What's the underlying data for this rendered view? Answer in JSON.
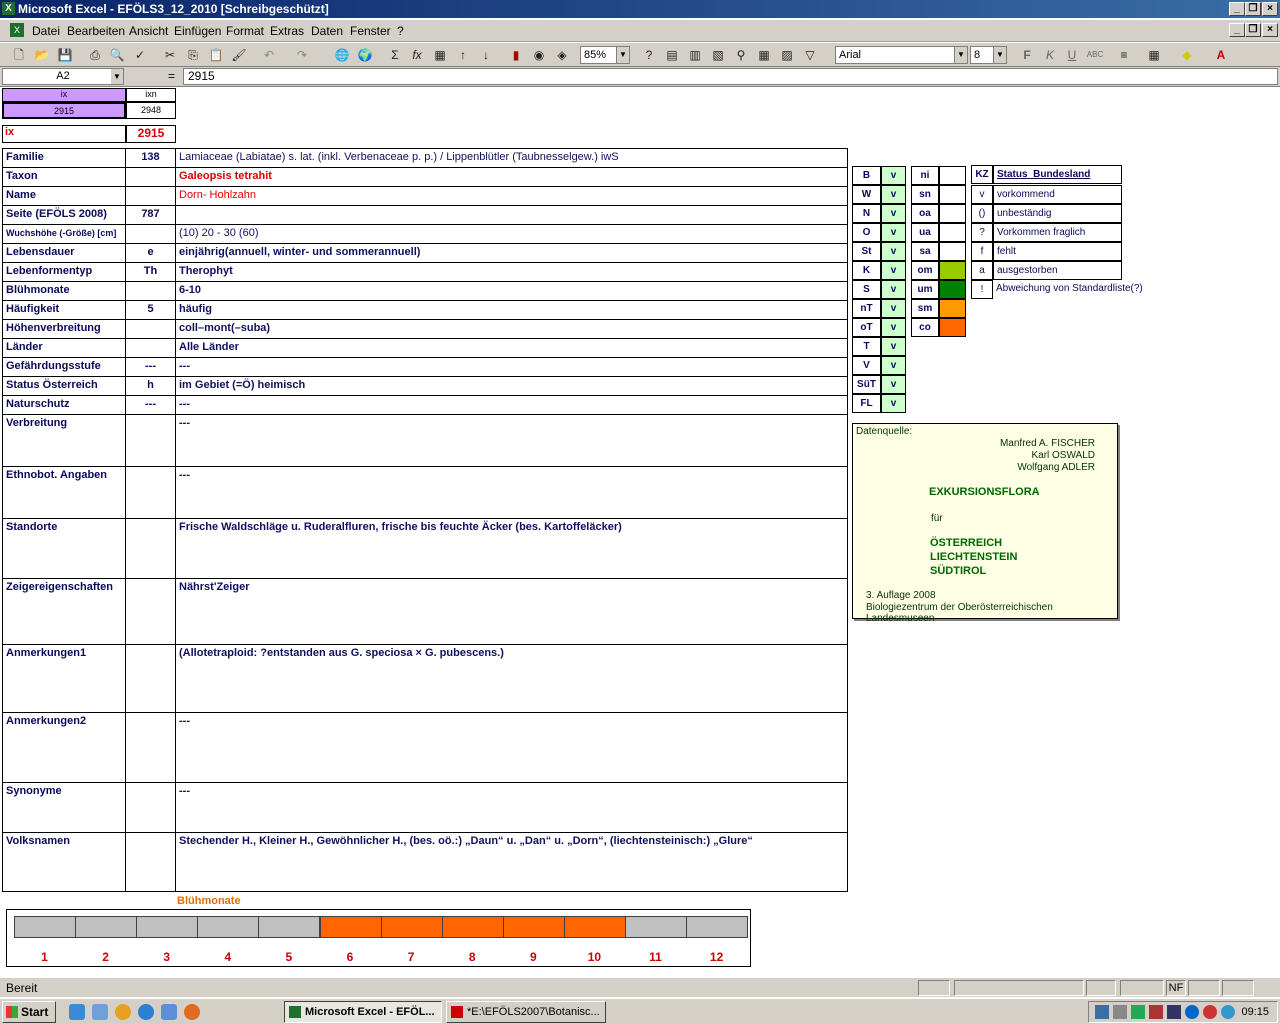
{
  "window": {
    "title": "Microsoft Excel - EFÖLS3_12_2010  [Schreibgeschützt]"
  },
  "menu": [
    "Datei",
    "Bearbeiten",
    "Ansicht",
    "Einfügen",
    "Format",
    "Extras",
    "Daten",
    "Fenster",
    "?"
  ],
  "toolbar": {
    "zoom": "85%",
    "font": "Arial",
    "size": "8",
    "bold": "F",
    "italic": "K",
    "underline": "U"
  },
  "formula": {
    "namebox": "A2",
    "eq": "=",
    "value": "2915"
  },
  "top": {
    "ix_header": "ix",
    "ixn_header": "ixn",
    "ix_val": "2915",
    "ixn_val": "2948",
    "ix_label": "ix",
    "ix_big": "2915"
  },
  "rows": [
    {
      "label": "Familie",
      "code": "138",
      "text": "Lamiaceae (Labiatae) s. lat. (inkl. Verbenaceae p. p.)  /  Lippenblütler (Taubnesselgew.) iwS"
    },
    {
      "label": "Taxon",
      "code": "",
      "text": "Galeopsis tetrahit"
    },
    {
      "label": "Name",
      "code": "",
      "text": "Dorn- Hohlzahn"
    },
    {
      "label": "Seite (EFÖLS 2008)",
      "code": "787",
      "text": ""
    },
    {
      "label": "Wuchshöhe (-Größe) [cm]",
      "code": "",
      "text": "(10) 20 - 30 (60)"
    },
    {
      "label": "Lebensdauer",
      "code": "e",
      "text": "einjährig(annuell, winter- und sommerannuell)"
    },
    {
      "label": "Lebenformentyp",
      "code": "Th",
      "text": "Therophyt"
    },
    {
      "label": "Blühmonate",
      "code": "",
      "text": "6-10"
    },
    {
      "label": "Häufigkeit",
      "code": "5",
      "text": "häufig"
    },
    {
      "label": "Höhenverbreitung",
      "code": "",
      "text": "coll–mont(–suba)"
    },
    {
      "label": "Länder",
      "code": "",
      "text": "Alle Länder"
    },
    {
      "label": "Gefährdungsstufe",
      "code": "---",
      "text": "---"
    },
    {
      "label": "Status Österreich",
      "code": "h",
      "text": "im Gebiet (=Ö) heimisch"
    },
    {
      "label": "Naturschutz",
      "code": "---",
      "text": "---"
    }
  ],
  "bigrows": [
    {
      "label": "Verbreitung",
      "text": "---"
    },
    {
      "label": "Ethnobot. Angaben",
      "text": "---"
    },
    {
      "label": "Standorte",
      "text": "Frische Waldschläge u. Ruderalfluren, frische bis feuchte Äcker (bes. Kartoffeläcker)"
    },
    {
      "label": "Zeigereigenschaften",
      "text": "Nährst'Zeiger"
    },
    {
      "label": "Anmerkungen1",
      "text": "(Allotetraploid: ?entstanden aus G. speciosa × G. pubescens.)"
    },
    {
      "label": "Anmerkungen2",
      "text": "---"
    },
    {
      "label": "Synonyme",
      "text": "---"
    },
    {
      "label": "Volksnamen",
      "text": "Stechender H., Kleiner H., Gewöhnlicher H.,  (bes. oö.:) „Daun“ u. „Dan“ u. „Dorn“, (liechtensteinisch:) „Glure“"
    }
  ],
  "states": [
    {
      "k": "B",
      "v": "v"
    },
    {
      "k": "W",
      "v": "v"
    },
    {
      "k": "N",
      "v": "v"
    },
    {
      "k": "O",
      "v": "v"
    },
    {
      "k": "St",
      "v": "v"
    },
    {
      "k": "K",
      "v": "v"
    },
    {
      "k": "S",
      "v": "v"
    },
    {
      "k": "nT",
      "v": "v"
    },
    {
      "k": "oT",
      "v": "v"
    },
    {
      "k": "T",
      "v": "v"
    },
    {
      "k": "V",
      "v": "v"
    },
    {
      "k": "SüT",
      "v": "v"
    },
    {
      "k": "FL",
      "v": "v"
    }
  ],
  "zones": [
    {
      "k": "ni",
      "color": "#ffffff"
    },
    {
      "k": "sn",
      "color": "#ffffff"
    },
    {
      "k": "oa",
      "color": "#ffffff"
    },
    {
      "k": "ua",
      "color": "#ffffff"
    },
    {
      "k": "sa",
      "color": "#ffffff"
    },
    {
      "k": "om",
      "color": "#99cc00"
    },
    {
      "k": "um",
      "color": "#008000"
    },
    {
      "k": "sm",
      "color": "#ff9900"
    },
    {
      "k": "co",
      "color": "#ff6600"
    }
  ],
  "kz": {
    "header_k": "KZ",
    "header_v": "Status_Bundesland",
    "items": [
      {
        "k": "v",
        "v": "vorkommend"
      },
      {
        "k": "()",
        "v": "unbeständig"
      },
      {
        "k": "?",
        "v": "Vorkommen fraglich"
      },
      {
        "k": "f",
        "v": "fehlt"
      },
      {
        "k": "a",
        "v": "ausgestorben"
      },
      {
        "k": "!",
        "v": "Abweichung von Standardliste(?)"
      }
    ]
  },
  "datenquelle": {
    "label": "Datenquelle:",
    "authors": [
      "Manfred A. FISCHER",
      "Karl OSWALD",
      "Wolfgang ADLER"
    ],
    "title": "EXKURSIONSFLORA",
    "fuer": "für",
    "countries": [
      "ÖSTERREICH",
      "LIECHTENSTEIN",
      "SÜDTIROL"
    ],
    "edition": "3. Auflage 2008",
    "publisher": "Biologiezentrum der Oberösterreichischen Landesmuseen"
  },
  "bloom": {
    "title": "Blühmonate",
    "months": [
      "1",
      "2",
      "3",
      "4",
      "5",
      "6",
      "7",
      "8",
      "9",
      "10",
      "11",
      "12"
    ],
    "active": [
      false,
      false,
      false,
      false,
      false,
      true,
      true,
      true,
      true,
      true,
      false,
      false
    ],
    "active_color": "#ff6600",
    "inactive_color": "#c0c0c0"
  },
  "status": {
    "text": "Bereit",
    "nf": "NF"
  },
  "taskbar": {
    "start": "Start",
    "task1": "Microsoft Excel - EFÖL...",
    "task2": "*E:\\EFÖLS2007\\Botanisc...",
    "clock": "09:15"
  }
}
